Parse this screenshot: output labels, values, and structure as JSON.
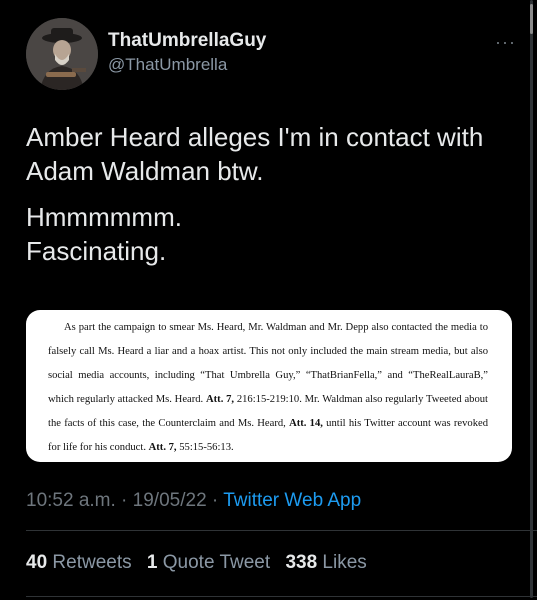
{
  "user": {
    "display_name": "ThatUmbrellaGuy",
    "handle": "@ThatUmbrella"
  },
  "more_menu": "···",
  "tweet": {
    "line1": "Amber Heard alleges I'm in contact with Adam Waldman btw.",
    "line2": "Hmmmmmm.",
    "line3": "Fascinating."
  },
  "document_excerpt": {
    "text_part1": "As part the campaign to smear Ms. Heard, Mr. Waldman and Mr. Depp also contacted the media to falsely call Ms. Heard a liar and a hoax artist. This not only included the main stream media, but also social media accounts, including “That Umbrella Guy,” “ThatBrianFella,” and “TheRealLauraB,” which regularly attacked Ms. Heard. ",
    "att1_bold": "Att. 7,",
    "text_part2": " 216:15-219:10. Mr. Waldman also regularly Tweeted about the facts of this case, the Counterclaim and Ms. Heard, ",
    "att2_bold": "Att. 14,",
    "text_part3": " until his Twitter account was revoked for life for his conduct. ",
    "att3_bold": "Att. 7,",
    "text_part4": " 55:15-56:13."
  },
  "meta": {
    "time": "10:52 a.m.",
    "sep1": " · ",
    "date": "19/05/22",
    "sep2": " · ",
    "source_app": "Twitter Web App"
  },
  "stats": {
    "retweets_count": "40",
    "retweets_label": "Retweets",
    "quote_count": "1",
    "quote_label": "Quote Tweet",
    "likes_count": "338",
    "likes_label": "Likes"
  },
  "colors": {
    "background": "#000000",
    "text_primary": "#e7e9ea",
    "text_secondary": "#6e767d",
    "link": "#1d9bf0",
    "card": "#ffffff"
  }
}
